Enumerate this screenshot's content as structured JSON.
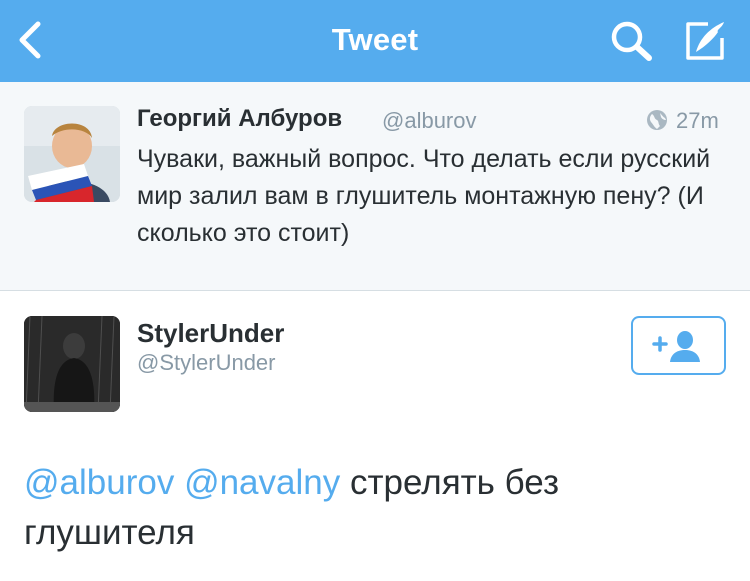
{
  "nav": {
    "title": "Tweet",
    "icons": [
      "back-chevron-icon",
      "search-icon",
      "compose-icon"
    ],
    "background_color": "#55acee"
  },
  "parent_tweet": {
    "author_name": "Георгий Албуров",
    "author_handle": "@alburov",
    "timestamp": "27m",
    "text": "Чуваки, важный вопрос. Что делать если русский мир залил вам в глушитель монтажную пену? (И сколько это стоит)",
    "icons": [
      "globe-icon"
    ]
  },
  "tweet": {
    "author_name": "StylerUnder",
    "author_handle": "@StylerUnder",
    "follow_icon": "add-user-icon",
    "mentions": [
      "@alburov",
      "@navalny"
    ],
    "body": "стрелять без глушителя"
  },
  "colors": {
    "accent": "#55acee",
    "text": "#292f33",
    "secondary_text": "#8899a6",
    "parent_background": "#f5f8fa"
  }
}
